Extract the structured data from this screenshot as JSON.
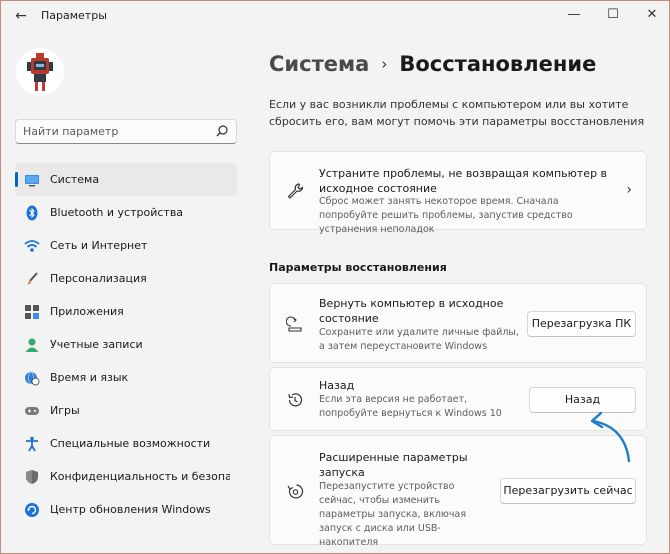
{
  "window": {
    "title": "Параметры",
    "back": "←",
    "minimize": "—",
    "maximize": "☐",
    "close": "✕"
  },
  "search": {
    "placeholder": "Найти параметр"
  },
  "sidebar": {
    "items": [
      {
        "label": "Система",
        "icon": "monitor-icon",
        "active": true
      },
      {
        "label": "Bluetooth и устройства",
        "icon": "bluetooth-icon"
      },
      {
        "label": "Сеть и Интернет",
        "icon": "wifi-icon"
      },
      {
        "label": "Персонализация",
        "icon": "brush-icon"
      },
      {
        "label": "Приложения",
        "icon": "apps-icon"
      },
      {
        "label": "Учетные записи",
        "icon": "account-icon"
      },
      {
        "label": "Время и язык",
        "icon": "globe-clock-icon"
      },
      {
        "label": "Игры",
        "icon": "gamepad-icon"
      },
      {
        "label": "Специальные возможности",
        "icon": "accessibility-icon"
      },
      {
        "label": "Конфиденциальность и безопас",
        "icon": "shield-icon"
      },
      {
        "label": "Центр обновления Windows",
        "icon": "update-icon"
      }
    ]
  },
  "main": {
    "breadcrumb_parent": "Система",
    "breadcrumb_sep": "›",
    "breadcrumb_current": "Восстановление",
    "intro": "Если у вас возникли проблемы с компьютером или вы хотите сбросить его, вам могут помочь эти параметры восстановления",
    "troubleshoot": {
      "title": "Устраните проблемы, не возвращая компьютер в исходное состояние",
      "desc": "Сброс может занять некоторое время. Сначала попробуйте решить проблемы, запустив средство устранения неполадок",
      "chevron": "›"
    },
    "section_title": "Параметры восстановления",
    "reset": {
      "title": "Вернуть компьютер в исходное состояние",
      "desc": "Сохраните или удалите личные файлы, а затем переустановите Windows",
      "button": "Перезагрузка ПК"
    },
    "goback": {
      "title": "Назад",
      "desc": "Если эта версия не работает, попробуйте вернуться к Windows 10",
      "button": "Назад"
    },
    "advanced": {
      "title": "Расширенные параметры запуска",
      "desc": "Перезапустите устройство сейчас, чтобы изменить параметры запуска, включая запуск с диска или USB-накопителя",
      "button": "Перезагрузить сейчас"
    }
  },
  "colors": {
    "accent": "#0067c0",
    "annotation_arrow": "#1e7cc8"
  }
}
